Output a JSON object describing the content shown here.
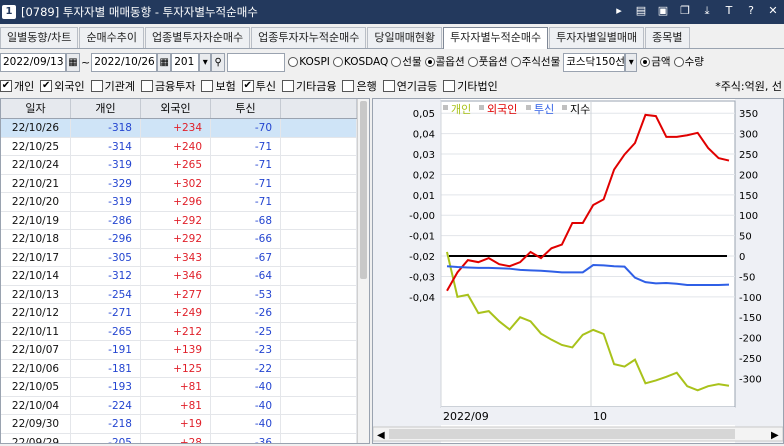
{
  "window": {
    "num": "1",
    "title": "[0789] 투자자별 매매동향 - 투자자별누적순매수"
  },
  "tabs": [
    "일별동향/차트",
    "순매수추이",
    "업종별투자자순매수",
    "업종투자자누적순매수",
    "당일매매현황",
    "투자자별누적순매수",
    "투자자별일별매매",
    "종목별"
  ],
  "active_tab": 5,
  "controls": {
    "date_from": "2022/09/13",
    "date_to": "2022/10/26",
    "count": "201",
    "radios": [
      {
        "label": "KOSPI",
        "on": false
      },
      {
        "label": "KOSDAQ",
        "on": false
      },
      {
        "label": "선물",
        "on": false
      },
      {
        "label": "콜옵션",
        "on": true
      },
      {
        "label": "풋옵션",
        "on": false
      },
      {
        "label": "주식선물",
        "on": false
      }
    ],
    "market_select": "코스닥150선",
    "value_radios": [
      {
        "label": "금액",
        "on": true
      },
      {
        "label": "수량",
        "on": false
      }
    ]
  },
  "checks": [
    {
      "label": "개인",
      "on": true
    },
    {
      "label": "외국인",
      "on": true
    },
    {
      "label": "기관계",
      "on": false
    },
    {
      "label": "금융투자",
      "on": false
    },
    {
      "label": "보험",
      "on": false
    },
    {
      "label": "투신",
      "on": true
    },
    {
      "label": "기타금융",
      "on": false
    },
    {
      "label": "은행",
      "on": false
    },
    {
      "label": "연기금등",
      "on": false
    },
    {
      "label": "기타법인",
      "on": false
    }
  ],
  "unit_text": "*주식:억원, 선",
  "table": {
    "headers": [
      "일자",
      "개인",
      "외국인",
      "투신",
      ""
    ],
    "rows": [
      [
        "22/10/26",
        "-318",
        "+234",
        "-70"
      ],
      [
        "22/10/25",
        "-314",
        "+240",
        "-71"
      ],
      [
        "22/10/24",
        "-319",
        "+265",
        "-71"
      ],
      [
        "22/10/21",
        "-329",
        "+302",
        "-71"
      ],
      [
        "22/10/20",
        "-319",
        "+296",
        "-71"
      ],
      [
        "22/10/19",
        "-286",
        "+292",
        "-68"
      ],
      [
        "22/10/18",
        "-296",
        "+292",
        "-66"
      ],
      [
        "22/10/17",
        "-305",
        "+343",
        "-67"
      ],
      [
        "22/10/14",
        "-312",
        "+346",
        "-64"
      ],
      [
        "22/10/13",
        "-254",
        "+277",
        "-53"
      ],
      [
        "22/10/12",
        "-271",
        "+249",
        "-26"
      ],
      [
        "22/10/11",
        "-265",
        "+212",
        "-25"
      ],
      [
        "22/10/07",
        "-191",
        "+139",
        "-23"
      ],
      [
        "22/10/06",
        "-181",
        "+125",
        "-22"
      ],
      [
        "22/10/05",
        "-193",
        "+81",
        "-40"
      ],
      [
        "22/10/04",
        "-224",
        "+81",
        "-40"
      ],
      [
        "22/09/30",
        "-218",
        "+19",
        "-40"
      ],
      [
        "22/09/29",
        "-205",
        "+28",
        "-36"
      ]
    ]
  },
  "chart_data": {
    "type": "line",
    "legend": [
      "개인",
      "외국인",
      "투신",
      "지수"
    ],
    "colors": {
      "개인": "#a9c21b",
      "외국인": "#e00000",
      "투신": "#2f5fe6",
      "지수": "#000000"
    },
    "left_ticks": [
      "0,05",
      "0,04",
      "0,03",
      "0,02",
      "0,01",
      "-0,00",
      "-0,01",
      "-0,02",
      "-0,03",
      "-0,04"
    ],
    "right_ticks": [
      "350",
      "300",
      "250",
      "200",
      "150",
      "100",
      "50",
      "0",
      "-50",
      "-100",
      "-150",
      "-200",
      "-250",
      "-300"
    ],
    "x_labels": [
      "2022/09",
      "10"
    ],
    "ylim_right": [
      -370,
      380
    ],
    "series": [
      {
        "name": "개인",
        "values": [
          10,
          -100,
          -95,
          -140,
          -135,
          -160,
          -180,
          -150,
          -160,
          -190,
          -205,
          -218,
          -224,
          -193,
          -181,
          -191,
          -265,
          -271,
          -254,
          -312,
          -305,
          -296,
          -286,
          -319,
          -329,
          -319,
          -314,
          -318
        ]
      },
      {
        "name": "외국인",
        "values": [
          -85,
          -40,
          -10,
          -15,
          -5,
          -20,
          -25,
          -15,
          10,
          -5,
          19,
          28,
          81,
          81,
          125,
          139,
          212,
          249,
          277,
          346,
          343,
          292,
          292,
          296,
          302,
          265,
          240,
          234
        ]
      },
      {
        "name": "투신",
        "values": [
          -25,
          -27,
          -28,
          -29,
          -29,
          -30,
          -31,
          -34,
          -35,
          -36,
          -38,
          -40,
          -40,
          -40,
          -22,
          -23,
          -25,
          -26,
          -53,
          -64,
          -67,
          -66,
          -68,
          -71,
          -71,
          -71,
          -71,
          -70
        ]
      }
    ]
  }
}
